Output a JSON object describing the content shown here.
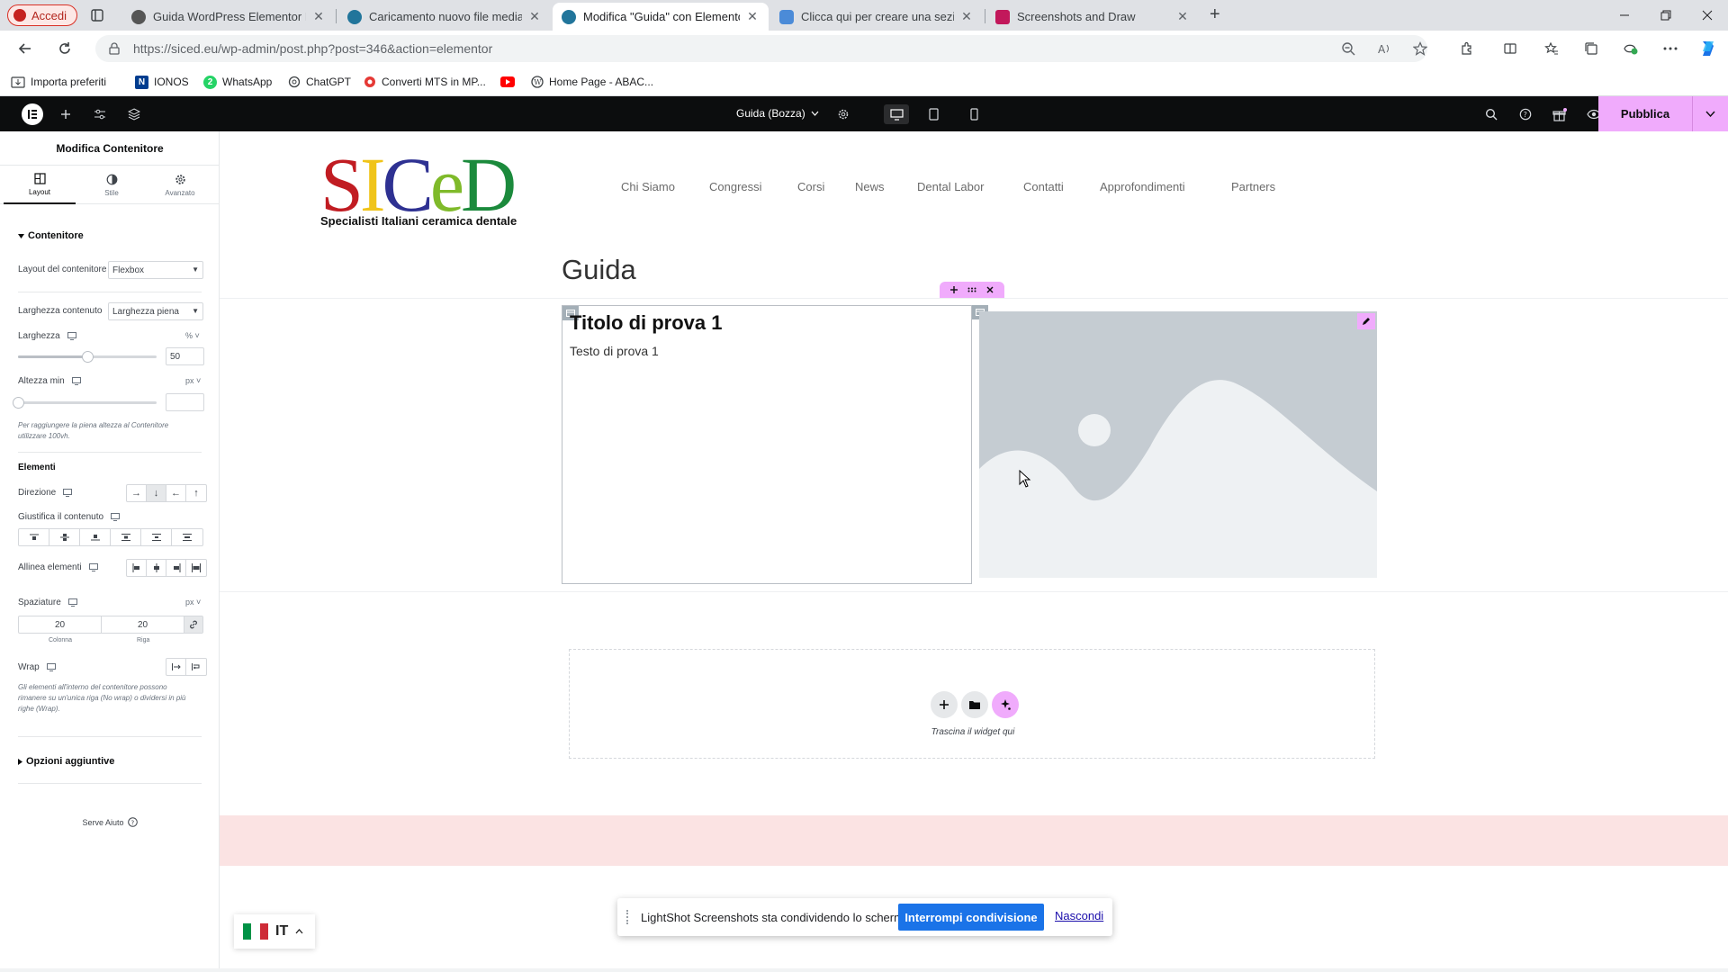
{
  "browser": {
    "profile_label": "Accedi",
    "tabs": [
      {
        "title": "Guida WordPress Elementor Princ"
      },
      {
        "title": "Caricamento nuovo file media ‹ E"
      },
      {
        "title": "Modifica \"Guida\" con Elementor"
      },
      {
        "title": "Clicca qui per creare una sezione"
      },
      {
        "title": "Screenshots and Draw"
      }
    ],
    "new_tab": "+",
    "close_glyph": "✕",
    "url": "https://siced.eu/wp-admin/post.php?post=346&action=elementor",
    "bookmarks": [
      {
        "label": "Importa preferiti"
      },
      {
        "label": "IONOS",
        "glyph": "N"
      },
      {
        "label": "WhatsApp",
        "glyph": "2"
      },
      {
        "label": "ChatGPT"
      },
      {
        "label": "Converti MTS in MP..."
      },
      {
        "label": ""
      },
      {
        "label": "Home Page - ABAC..."
      }
    ]
  },
  "elementor": {
    "document_title": "Guida (Bozza)",
    "publish_label": "Pubblica"
  },
  "panel": {
    "title": "Modifica Contenitore",
    "tabs": [
      {
        "label": "Layout"
      },
      {
        "label": "Stile"
      },
      {
        "label": "Avanzato"
      }
    ],
    "section_container": "Contenitore",
    "container_layout_label": "Layout del contenitore",
    "container_layout_value": "Flexbox",
    "content_width_label": "Larghezza contenuto",
    "content_width_value": "Larghezza piena",
    "width_label": "Larghezza",
    "width_unit": "% ˅",
    "width_value": "50",
    "width_fraction": 0.5,
    "min_height_label": "Altezza min",
    "min_height_unit": "px ˅",
    "min_height_value": "",
    "min_height_help": "Per raggiungere la piena altezza al Contenitore utilizzare 100vh.",
    "elements_heading": "Elementi",
    "direction_label": "Direzione",
    "direction_options": [
      "→",
      "↓",
      "←",
      "↑"
    ],
    "direction_selected": 1,
    "justify_label": "Giustifica il contenuto",
    "align_label": "Allinea elementi",
    "gap_label": "Spaziature",
    "gap_unit": "px ˅",
    "gap_column": "20",
    "gap_row": "20",
    "gap_column_label": "Colonna",
    "gap_row_label": "Riga",
    "wrap_label": "Wrap",
    "wrap_help": "Gli elementi all'interno del contenitore possono rimanere su un'unica riga (No wrap) o dividersi in più righe (Wrap).",
    "section_additional": "Opzioni aggiuntive",
    "help_label": "Serve Aiuto"
  },
  "site": {
    "logo_letters": [
      "S",
      "I",
      "C",
      "e",
      "D"
    ],
    "tagline": "Specialisti Italiani ceramica dentale",
    "nav": [
      "Chi Siamo",
      "Congressi",
      "Corsi",
      "News",
      "Dental Labor",
      "Contatti",
      "Approfondimenti",
      "Partners"
    ],
    "page_title": "Guida",
    "box_title": "Titolo di prova 1",
    "box_text": "Testo di prova 1",
    "drop_text": "Trascina il widget qui"
  },
  "share_banner": {
    "message": "LightShot Screenshots sta condividendo lo schermo.",
    "stop_label": "Interrompi condivisione",
    "hide_label": "Nascondi"
  },
  "language": {
    "code": "IT",
    "flag_colors": [
      "#009246",
      "#ffffff",
      "#ce2b37"
    ]
  },
  "colors": {
    "accent_pink": "#f0abfc",
    "elementor_bar": "#0c0d0e",
    "share_blue": "#1a73e8"
  }
}
